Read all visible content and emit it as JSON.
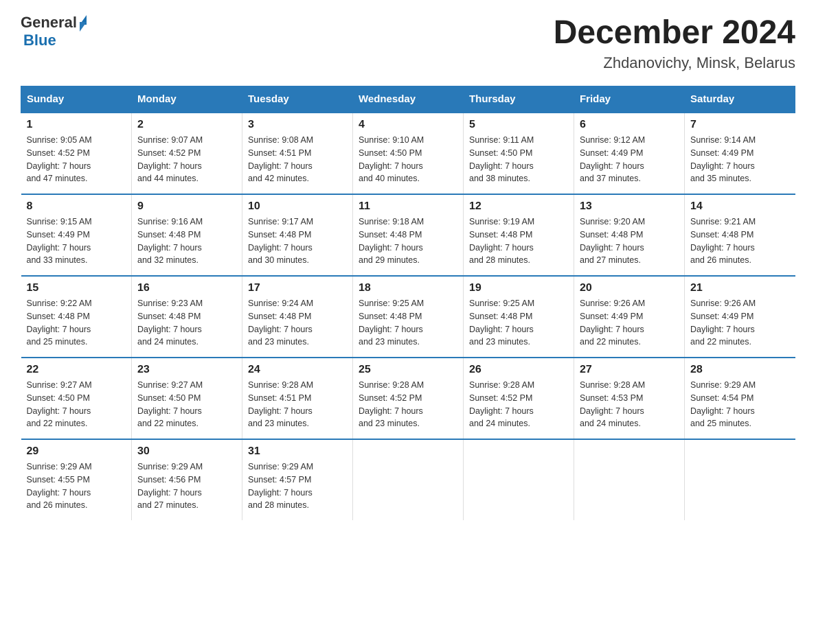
{
  "header": {
    "logo_general": "General",
    "logo_blue": "Blue",
    "month_title": "December 2024",
    "subtitle": "Zhdanovichy, Minsk, Belarus"
  },
  "weekdays": [
    "Sunday",
    "Monday",
    "Tuesday",
    "Wednesday",
    "Thursday",
    "Friday",
    "Saturday"
  ],
  "weeks": [
    [
      {
        "day": "1",
        "info": "Sunrise: 9:05 AM\nSunset: 4:52 PM\nDaylight: 7 hours\nand 47 minutes."
      },
      {
        "day": "2",
        "info": "Sunrise: 9:07 AM\nSunset: 4:52 PM\nDaylight: 7 hours\nand 44 minutes."
      },
      {
        "day": "3",
        "info": "Sunrise: 9:08 AM\nSunset: 4:51 PM\nDaylight: 7 hours\nand 42 minutes."
      },
      {
        "day": "4",
        "info": "Sunrise: 9:10 AM\nSunset: 4:50 PM\nDaylight: 7 hours\nand 40 minutes."
      },
      {
        "day": "5",
        "info": "Sunrise: 9:11 AM\nSunset: 4:50 PM\nDaylight: 7 hours\nand 38 minutes."
      },
      {
        "day": "6",
        "info": "Sunrise: 9:12 AM\nSunset: 4:49 PM\nDaylight: 7 hours\nand 37 minutes."
      },
      {
        "day": "7",
        "info": "Sunrise: 9:14 AM\nSunset: 4:49 PM\nDaylight: 7 hours\nand 35 minutes."
      }
    ],
    [
      {
        "day": "8",
        "info": "Sunrise: 9:15 AM\nSunset: 4:49 PM\nDaylight: 7 hours\nand 33 minutes."
      },
      {
        "day": "9",
        "info": "Sunrise: 9:16 AM\nSunset: 4:48 PM\nDaylight: 7 hours\nand 32 minutes."
      },
      {
        "day": "10",
        "info": "Sunrise: 9:17 AM\nSunset: 4:48 PM\nDaylight: 7 hours\nand 30 minutes."
      },
      {
        "day": "11",
        "info": "Sunrise: 9:18 AM\nSunset: 4:48 PM\nDaylight: 7 hours\nand 29 minutes."
      },
      {
        "day": "12",
        "info": "Sunrise: 9:19 AM\nSunset: 4:48 PM\nDaylight: 7 hours\nand 28 minutes."
      },
      {
        "day": "13",
        "info": "Sunrise: 9:20 AM\nSunset: 4:48 PM\nDaylight: 7 hours\nand 27 minutes."
      },
      {
        "day": "14",
        "info": "Sunrise: 9:21 AM\nSunset: 4:48 PM\nDaylight: 7 hours\nand 26 minutes."
      }
    ],
    [
      {
        "day": "15",
        "info": "Sunrise: 9:22 AM\nSunset: 4:48 PM\nDaylight: 7 hours\nand 25 minutes."
      },
      {
        "day": "16",
        "info": "Sunrise: 9:23 AM\nSunset: 4:48 PM\nDaylight: 7 hours\nand 24 minutes."
      },
      {
        "day": "17",
        "info": "Sunrise: 9:24 AM\nSunset: 4:48 PM\nDaylight: 7 hours\nand 23 minutes."
      },
      {
        "day": "18",
        "info": "Sunrise: 9:25 AM\nSunset: 4:48 PM\nDaylight: 7 hours\nand 23 minutes."
      },
      {
        "day": "19",
        "info": "Sunrise: 9:25 AM\nSunset: 4:48 PM\nDaylight: 7 hours\nand 23 minutes."
      },
      {
        "day": "20",
        "info": "Sunrise: 9:26 AM\nSunset: 4:49 PM\nDaylight: 7 hours\nand 22 minutes."
      },
      {
        "day": "21",
        "info": "Sunrise: 9:26 AM\nSunset: 4:49 PM\nDaylight: 7 hours\nand 22 minutes."
      }
    ],
    [
      {
        "day": "22",
        "info": "Sunrise: 9:27 AM\nSunset: 4:50 PM\nDaylight: 7 hours\nand 22 minutes."
      },
      {
        "day": "23",
        "info": "Sunrise: 9:27 AM\nSunset: 4:50 PM\nDaylight: 7 hours\nand 22 minutes."
      },
      {
        "day": "24",
        "info": "Sunrise: 9:28 AM\nSunset: 4:51 PM\nDaylight: 7 hours\nand 23 minutes."
      },
      {
        "day": "25",
        "info": "Sunrise: 9:28 AM\nSunset: 4:52 PM\nDaylight: 7 hours\nand 23 minutes."
      },
      {
        "day": "26",
        "info": "Sunrise: 9:28 AM\nSunset: 4:52 PM\nDaylight: 7 hours\nand 24 minutes."
      },
      {
        "day": "27",
        "info": "Sunrise: 9:28 AM\nSunset: 4:53 PM\nDaylight: 7 hours\nand 24 minutes."
      },
      {
        "day": "28",
        "info": "Sunrise: 9:29 AM\nSunset: 4:54 PM\nDaylight: 7 hours\nand 25 minutes."
      }
    ],
    [
      {
        "day": "29",
        "info": "Sunrise: 9:29 AM\nSunset: 4:55 PM\nDaylight: 7 hours\nand 26 minutes."
      },
      {
        "day": "30",
        "info": "Sunrise: 9:29 AM\nSunset: 4:56 PM\nDaylight: 7 hours\nand 27 minutes."
      },
      {
        "day": "31",
        "info": "Sunrise: 9:29 AM\nSunset: 4:57 PM\nDaylight: 7 hours\nand 28 minutes."
      },
      {
        "day": "",
        "info": ""
      },
      {
        "day": "",
        "info": ""
      },
      {
        "day": "",
        "info": ""
      },
      {
        "day": "",
        "info": ""
      }
    ]
  ]
}
